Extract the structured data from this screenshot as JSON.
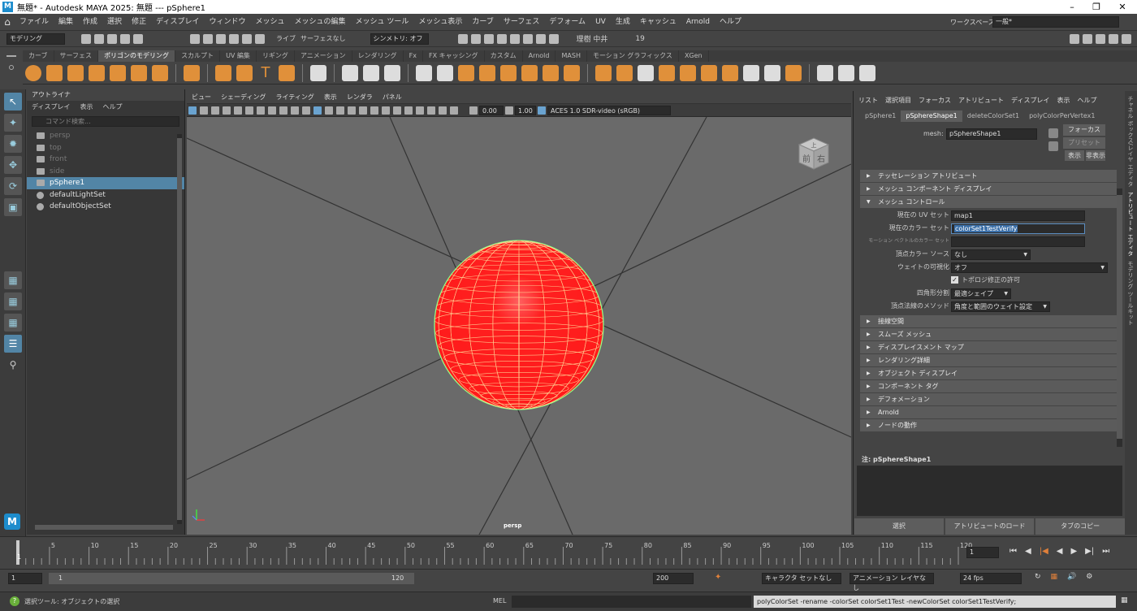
{
  "window": {
    "title": "無題* - Autodesk MAYA 2025: 無題  ---  pSphere1",
    "logo": "M"
  },
  "menubar": [
    "ファイル",
    "編集",
    "作成",
    "選択",
    "修正",
    "ディスプレイ",
    "ウィンドウ",
    "メッシュ",
    "メッシュの編集",
    "メッシュ ツール",
    "メッシュ表示",
    "カーブ",
    "サーフェス",
    "デフォーム",
    "UV",
    "生成",
    "キャッシュ",
    "Arnold",
    "ヘルプ"
  ],
  "workspace": {
    "label": "ワークスペース :",
    "value": "一般*"
  },
  "statusline": {
    "mode": "モデリング",
    "live": "ライブ",
    "live_value": "サーフェスなし",
    "symmetry": "シンメトリ: オフ",
    "user": "理樹 中井",
    "count": "19"
  },
  "shelf_tabs": [
    "カーブ",
    "サーフェス",
    "ポリゴンのモデリング",
    "スカルプト",
    "UV 編集",
    "リギング",
    "アニメーション",
    "レンダリング",
    "Fx",
    "FX キャッシング",
    "カスタム",
    "Arnold",
    "MASH",
    "モーション グラフィックス",
    "XGen"
  ],
  "shelf_active": "ポリゴンのモデリング",
  "outliner": {
    "title": "アウトライナ",
    "menus": [
      "ディスプレイ",
      "表示",
      "ヘルプ"
    ],
    "search_placeholder": "コマンド検索...",
    "items": [
      {
        "label": "persp",
        "type": "camera"
      },
      {
        "label": "top",
        "type": "camera"
      },
      {
        "label": "front",
        "type": "camera"
      },
      {
        "label": "side",
        "type": "camera"
      },
      {
        "label": "pSphere1",
        "type": "mesh",
        "selected": true
      },
      {
        "label": "defaultLightSet",
        "type": "set"
      },
      {
        "label": "defaultObjectSet",
        "type": "set"
      }
    ]
  },
  "viewport": {
    "menus": [
      "ビュー",
      "シェーディング",
      "ライティング",
      "表示",
      "レンダラ",
      "パネル"
    ],
    "exposure": "0.00",
    "gamma": "1.00",
    "colorspace": "ACES 1.0 SDR-video (sRGB)",
    "camera_label": "persp",
    "viewcube_front": "前",
    "viewcube_right": "右",
    "viewcube_top": "上",
    "sphere_color": "#ff1a1a"
  },
  "attribute_editor": {
    "menus": [
      "リスト",
      "選択項目",
      "フォーカス",
      "アトリビュート",
      "ディスプレイ",
      "表示",
      "ヘルプ"
    ],
    "tabs": [
      "pSphere1",
      "pSphereShape1",
      "deleteColorSet1",
      "polyColorPerVertex1"
    ],
    "active_tab": "pSphereShape1",
    "mesh_label": "mesh:",
    "mesh_value": "pSphereShape1",
    "focus_button": "フォーカス",
    "preset_button": "プリセット",
    "show_button": "表示",
    "hide_button": "非表示",
    "sections_top": [
      "テッセレーション アトリビュート",
      "メッシュ コンポーネント ディスプレイ"
    ],
    "open_section": "メッシュ コントロール",
    "fields": [
      {
        "label": "現在の UV セット",
        "value": "map1"
      },
      {
        "label": "現在のカラー セット",
        "value": "colorSet1TestVerify"
      },
      {
        "label": "モーション ベクトルのカラー セット",
        "value": ""
      },
      {
        "label": "頂点カラー ソース",
        "value": "なし"
      },
      {
        "label": "ウェイトの可視化",
        "value": "オフ"
      }
    ],
    "topology_checkbox": "トポロジ修正の許可",
    "quad_split_label": "四角形分割",
    "quad_split_value": "最適シェイプ",
    "normal_method_label": "頂点法線のメソッド",
    "normal_method_value": "角度と範囲のウェイト設定",
    "sections_bottom": [
      "接線空間",
      "スムーズ メッシュ",
      "ディスプレイスメント マップ",
      "レンダリング詳細",
      "オブジェクト ディスプレイ",
      "コンポーネント タグ",
      "デフォメーション",
      "Arnold",
      "ノードの動作"
    ],
    "notes_label": "注: pSphereShape1",
    "buttons": [
      "選択",
      "アトリビュートのロード",
      "タブのコピー"
    ]
  },
  "right_tabs": [
    "チャネル ボックス/レイヤ エディタ",
    "アトリビュート エディタ",
    "モデリング ツールキット"
  ],
  "timeline": {
    "ticks": [
      "5",
      "10",
      "15",
      "20",
      "25",
      "30",
      "35",
      "40",
      "45",
      "50",
      "55",
      "60",
      "65",
      "70",
      "75",
      "80",
      "85",
      "90",
      "95",
      "100",
      "105",
      "110",
      "115",
      "120"
    ],
    "start_marker": "1",
    "current_frame": "1"
  },
  "range": {
    "start": "1",
    "inner_start": "1",
    "inner_end": "120",
    "end": "200",
    "character_set": "キャラクタ セットなし",
    "anim_layer": "アニメーション レイヤなし",
    "fps": "24 fps"
  },
  "commandline": {
    "help_text": "選択ツール: オブジェクトの選択",
    "lang": "MEL",
    "result": "polyColorSet -rename -colorSet colorSet1Test -newColorSet colorSet1TestVerify;"
  }
}
